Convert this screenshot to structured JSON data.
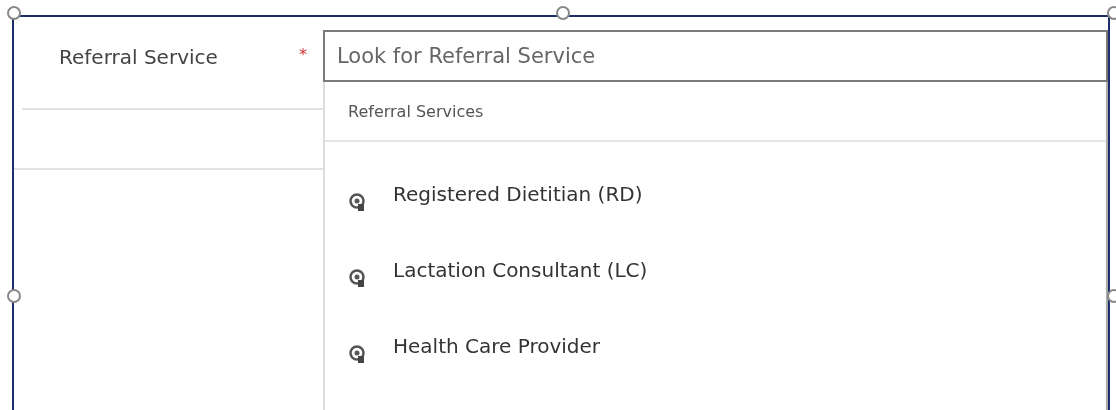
{
  "field": {
    "label": "Referral Service",
    "required_mark": "*",
    "required": true,
    "placeholder": "Look for Referral Service"
  },
  "dropdown": {
    "header": "Referral Services",
    "items": [
      {
        "label": "Registered Dietitian (RD)"
      },
      {
        "label": "Lactation Consultant (LC)"
      },
      {
        "label": "Health Care Provider"
      }
    ]
  }
}
